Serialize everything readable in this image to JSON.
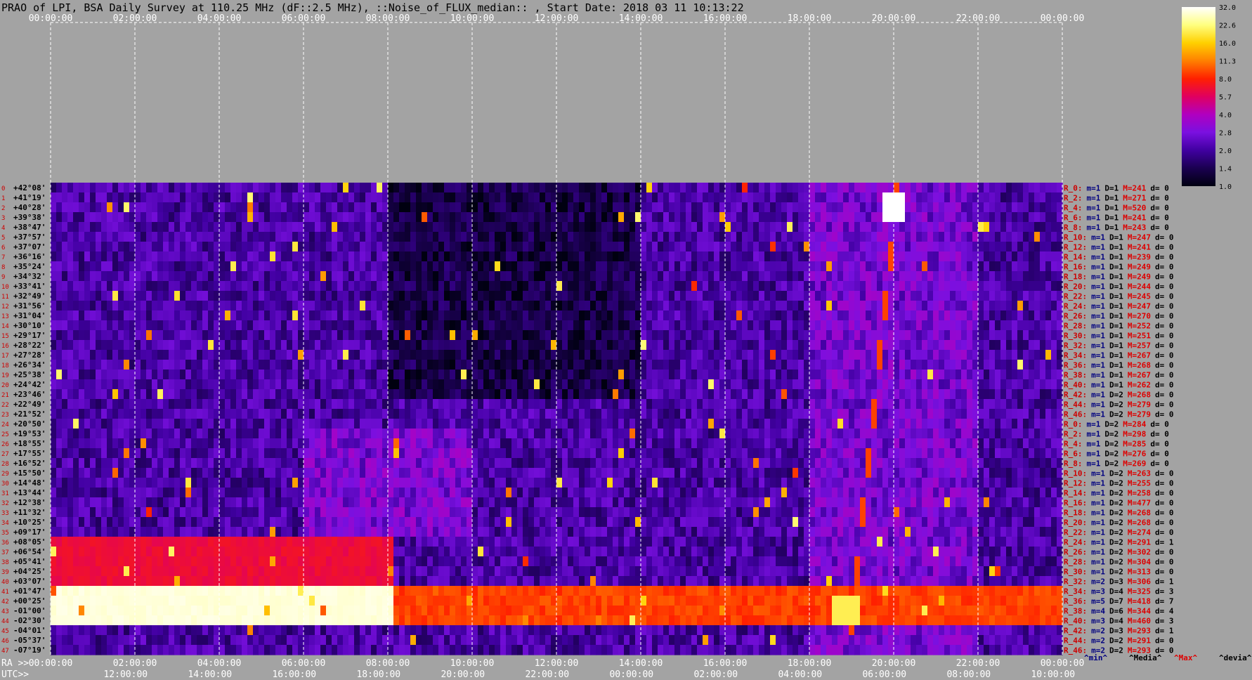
{
  "title": "PRAO of LPI, BSA Daily Survey at 110.25 MHz (dF::2.5 MHz), ::Noise_of_FLUX_median:: , Start Date: 2018 03 11 10:13:22",
  "time_axis": {
    "top_ticks": [
      "00:00:00",
      "02:00:00",
      "04:00:00",
      "06:00:00",
      "08:00:00",
      "10:00:00",
      "12:00:00",
      "14:00:00",
      "16:00:00",
      "18:00:00",
      "20:00:00",
      "22:00:00",
      "00:00:00"
    ],
    "ra_label": "RA >>",
    "ra_ticks": [
      "00:00:00",
      "02:00:00",
      "04:00:00",
      "06:00:00",
      "08:00:00",
      "10:00:00",
      "12:00:00",
      "14:00:00",
      "16:00:00",
      "18:00:00",
      "20:00:00",
      "22:00:00",
      "00:00:00"
    ],
    "utc_label": "UTC>>",
    "utc_ticks": [
      "12:00:00",
      "14:00:00",
      "16:00:00",
      "18:00:00",
      "20:00:00",
      "22:00:00",
      "00:00:00",
      "02:00:00",
      "04:00:00",
      "06:00:00",
      "08:00:00",
      "10:00:00"
    ]
  },
  "declinations": [
    "+42°08'",
    "+41°19'",
    "+40°28'",
    "+39°38'",
    "+38°47'",
    "+37°57'",
    "+37°07'",
    "+36°16'",
    "+35°24'",
    "+34°32'",
    "+33°41'",
    "+32°49'",
    "+31°56'",
    "+31°04'",
    "+30°10'",
    "+29°17'",
    "+28°22'",
    "+27°28'",
    "+26°34'",
    "+25°38'",
    "+24°42'",
    "+23°46'",
    "+22°49'",
    "+21°52'",
    "+20°50'",
    "+19°53'",
    "+18°55'",
    "+17°55'",
    "+16°52'",
    "+15°50'",
    "+14°48'",
    "+13°44'",
    "+12°38'",
    "+11°32'",
    "+10°25'",
    "+09°17'",
    "+08°05'",
    "+06°54'",
    "+05°41'",
    "+04°25'",
    "+03°07'",
    "+01°47'",
    "+00°25'",
    "-01°00'",
    "-02°30'",
    "-04°01'",
    "-05°37'",
    "-07°19'"
  ],
  "beam_rows": [
    {
      "r": "R_0:",
      "m": "m=1",
      "d": "D=1",
      "mx": "M=241",
      "dv": "d= 0"
    },
    {
      "r": "R_2:",
      "m": "m=1",
      "d": "D=1",
      "mx": "M=271",
      "dv": "d= 0"
    },
    {
      "r": "R_4:",
      "m": "m=1",
      "d": "D=1",
      "mx": "M=520",
      "dv": "d= 0"
    },
    {
      "r": "R_6:",
      "m": "m=1",
      "d": "D=1",
      "mx": "M=241",
      "dv": "d= 0"
    },
    {
      "r": "R_8:",
      "m": "m=1",
      "d": "D=1",
      "mx": "M=243",
      "dv": "d= 0"
    },
    {
      "r": "R_10:",
      "m": "m=1",
      "d": "D=1",
      "mx": "M=247",
      "dv": "d= 0"
    },
    {
      "r": "R_12:",
      "m": "m=1",
      "d": "D=1",
      "mx": "M=241",
      "dv": "d= 0"
    },
    {
      "r": "R_14:",
      "m": "m=1",
      "d": "D=1",
      "mx": "M=239",
      "dv": "d= 0"
    },
    {
      "r": "R_16:",
      "m": "m=1",
      "d": "D=1",
      "mx": "M=249",
      "dv": "d= 0"
    },
    {
      "r": "R_18:",
      "m": "m=1",
      "d": "D=1",
      "mx": "M=249",
      "dv": "d= 0"
    },
    {
      "r": "R_20:",
      "m": "m=1",
      "d": "D=1",
      "mx": "M=244",
      "dv": "d= 0"
    },
    {
      "r": "R_22:",
      "m": "m=1",
      "d": "D=1",
      "mx": "M=245",
      "dv": "d= 0"
    },
    {
      "r": "R_24:",
      "m": "m=1",
      "d": "D=1",
      "mx": "M=247",
      "dv": "d= 0"
    },
    {
      "r": "R_26:",
      "m": "m=1",
      "d": "D=1",
      "mx": "M=270",
      "dv": "d= 0"
    },
    {
      "r": "R_28:",
      "m": "m=1",
      "d": "D=1",
      "mx": "M=252",
      "dv": "d= 0"
    },
    {
      "r": "R_30:",
      "m": "m=1",
      "d": "D=1",
      "mx": "M=251",
      "dv": "d= 0"
    },
    {
      "r": "R_32:",
      "m": "m=1",
      "d": "D=1",
      "mx": "M=257",
      "dv": "d= 0"
    },
    {
      "r": "R_34:",
      "m": "m=1",
      "d": "D=1",
      "mx": "M=267",
      "dv": "d= 0"
    },
    {
      "r": "R_36:",
      "m": "m=1",
      "d": "D=1",
      "mx": "M=268",
      "dv": "d= 0"
    },
    {
      "r": "R_38:",
      "m": "m=1",
      "d": "D=1",
      "mx": "M=267",
      "dv": "d= 0"
    },
    {
      "r": "R_40:",
      "m": "m=1",
      "d": "D=1",
      "mx": "M=262",
      "dv": "d= 0"
    },
    {
      "r": "R_42:",
      "m": "m=1",
      "d": "D=2",
      "mx": "M=268",
      "dv": "d= 0"
    },
    {
      "r": "R_44:",
      "m": "m=1",
      "d": "D=2",
      "mx": "M=279",
      "dv": "d= 0"
    },
    {
      "r": "R_46:",
      "m": "m=1",
      "d": "D=2",
      "mx": "M=279",
      "dv": "d= 0"
    },
    {
      "r": "R_0:",
      "m": "m=1",
      "d": "D=2",
      "mx": "M=284",
      "dv": "d= 0"
    },
    {
      "r": "R_2:",
      "m": "m=1",
      "d": "D=2",
      "mx": "M=298",
      "dv": "d= 0"
    },
    {
      "r": "R_4:",
      "m": "m=1",
      "d": "D=2",
      "mx": "M=285",
      "dv": "d= 0"
    },
    {
      "r": "R_6:",
      "m": "m=1",
      "d": "D=2",
      "mx": "M=276",
      "dv": "d= 0"
    },
    {
      "r": "R_8:",
      "m": "m=1",
      "d": "D=2",
      "mx": "M=269",
      "dv": "d= 0"
    },
    {
      "r": "R_10:",
      "m": "m=1",
      "d": "D=2",
      "mx": "M=263",
      "dv": "d= 0"
    },
    {
      "r": "R_12:",
      "m": "m=1",
      "d": "D=2",
      "mx": "M=255",
      "dv": "d= 0"
    },
    {
      "r": "R_14:",
      "m": "m=1",
      "d": "D=2",
      "mx": "M=258",
      "dv": "d= 0"
    },
    {
      "r": "R_16:",
      "m": "m=1",
      "d": "D=2",
      "mx": "M=477",
      "dv": "d= 0"
    },
    {
      "r": "R_18:",
      "m": "m=1",
      "d": "D=2",
      "mx": "M=268",
      "dv": "d= 0"
    },
    {
      "r": "R_20:",
      "m": "m=1",
      "d": "D=2",
      "mx": "M=268",
      "dv": "d= 0"
    },
    {
      "r": "R_22:",
      "m": "m=1",
      "d": "D=2",
      "mx": "M=274",
      "dv": "d= 0"
    },
    {
      "r": "R_24:",
      "m": "m=1",
      "d": "D=2",
      "mx": "M=291",
      "dv": "d= 1"
    },
    {
      "r": "R_26:",
      "m": "m=1",
      "d": "D=2",
      "mx": "M=302",
      "dv": "d= 0"
    },
    {
      "r": "R_28:",
      "m": "m=1",
      "d": "D=2",
      "mx": "M=304",
      "dv": "d= 0"
    },
    {
      "r": "R_30:",
      "m": "m=1",
      "d": "D=2",
      "mx": "M=313",
      "dv": "d= 0"
    },
    {
      "r": "R_32:",
      "m": "m=2",
      "d": "D=3",
      "mx": "M=306",
      "dv": "d= 1"
    },
    {
      "r": "R_34:",
      "m": "m=3",
      "d": "D=4",
      "mx": "M=325",
      "dv": "d= 3"
    },
    {
      "r": "R_36:",
      "m": "m=5",
      "d": "D=7",
      "mx": "M=418",
      "dv": "d= 7"
    },
    {
      "r": "R_38:",
      "m": "m=4",
      "d": "D=6",
      "mx": "M=344",
      "dv": "d= 4"
    },
    {
      "r": "R_40:",
      "m": "m=3",
      "d": "D=4",
      "mx": "M=460",
      "dv": "d= 3"
    },
    {
      "r": "R_42:",
      "m": "m=2",
      "d": "D=3",
      "mx": "M=293",
      "dv": "d= 1"
    },
    {
      "r": "R_44:",
      "m": "m=2",
      "d": "D=2",
      "mx": "M=291",
      "dv": "d= 0"
    },
    {
      "r": "R_46:",
      "m": "m=2",
      "d": "D=2",
      "mx": "M=293",
      "dv": "d= 0"
    }
  ],
  "footer_legend": [
    "^min^",
    "^Media^",
    "^Max^",
    "^devia^"
  ],
  "colorbar": {
    "ticks": [
      "32.0",
      "22.6",
      "16.0",
      "11.3",
      "8.0",
      "5.7",
      "4.0",
      "2.8",
      "2.0",
      "1.4",
      "1.0"
    ],
    "stops": [
      "#000010",
      "#1a0050",
      "#4000a0",
      "#7a10e0",
      "#b000c0",
      "#e00060",
      "#ff2000",
      "#ff8000",
      "#ffd000",
      "#ffff80",
      "#ffffff"
    ]
  },
  "colors": {
    "background": "#a3a3a3",
    "beam_id": "#cc0000",
    "m_value": "#000080",
    "D_value": "#000000",
    "M_value": "#dd0000",
    "devia": "#000000"
  },
  "chart_data": {
    "type": "heatmap",
    "title": "PRAO of LPI, BSA Daily Survey at 110.25 MHz (dF::2.5 MHz), ::Noise_of_FLUX_median:: , Start Date: 2018 03 11 10:13:22",
    "x_axis": "RA 00:00:00 to 24:00:00 (2-hour ticks); UTC 10:13:22 start",
    "y_axis": "48 beams, declination +42°08' to -07°19'",
    "color_scale": {
      "min": 1.0,
      "max": 32.0,
      "log": true
    },
    "features": [
      {
        "name": "strong band beams 41-44",
        "ra_start_h": 0.0,
        "ra_end_h": 8.2,
        "level": 30.0
      },
      {
        "name": "moderate band beams 36-40",
        "ra_start_h": 0.0,
        "ra_end_h": 8.2,
        "level": 6.0
      },
      {
        "name": "continuing band beams 41-44",
        "ra_start_h": 8.2,
        "ra_end_h": 24.0,
        "level": 8.0
      },
      {
        "name": "diagonal drift",
        "ra_start_h": 19.0,
        "ra_end_h": 20.1,
        "beam_start": 44,
        "beam_end": 0,
        "level": 9.0
      },
      {
        "name": "bright source",
        "ra_h": 20.0,
        "beam": 2,
        "level": 32.0
      },
      {
        "name": "burst",
        "ra_h": 18.9,
        "beam": 43,
        "level": 20.0
      }
    ]
  }
}
